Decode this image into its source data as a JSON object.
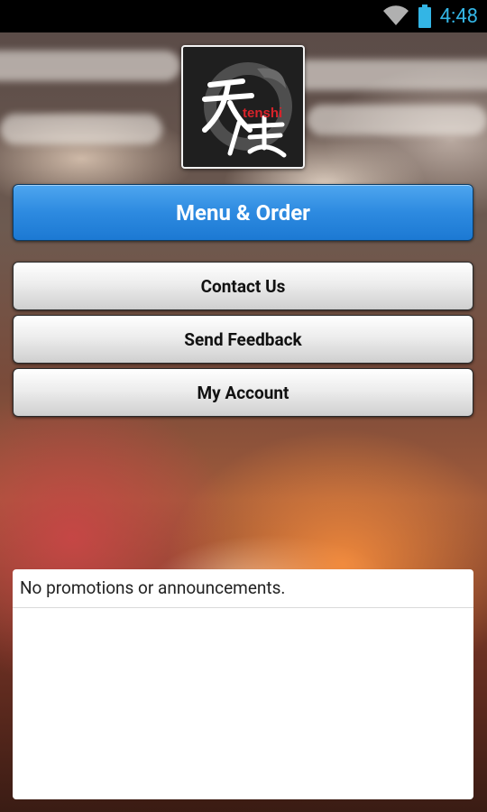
{
  "status_bar": {
    "time": "4:48",
    "icons": [
      "wifi-icon",
      "battery-icon"
    ],
    "accent_color": "#33b5e5"
  },
  "logo": {
    "text": "tenshi",
    "kanji": "天使"
  },
  "buttons": {
    "menu_order": "Menu & Order",
    "contact_us": "Contact Us",
    "send_feedback": "Send Feedback",
    "my_account": "My Account"
  },
  "promotions": {
    "empty_message": "No promotions or announcements."
  },
  "colors": {
    "primary_button": "#2d8ae0",
    "secondary_button": "#e6e6e6"
  }
}
